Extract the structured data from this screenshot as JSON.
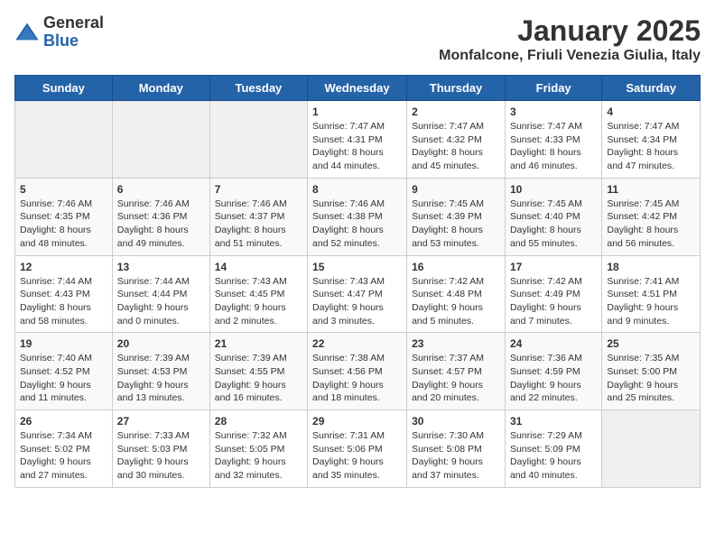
{
  "logo": {
    "general": "General",
    "blue": "Blue"
  },
  "title": "January 2025",
  "subtitle": "Monfalcone, Friuli Venezia Giulia, Italy",
  "days_of_week": [
    "Sunday",
    "Monday",
    "Tuesday",
    "Wednesday",
    "Thursday",
    "Friday",
    "Saturday"
  ],
  "weeks": [
    [
      {
        "day": "",
        "info": ""
      },
      {
        "day": "",
        "info": ""
      },
      {
        "day": "",
        "info": ""
      },
      {
        "day": "1",
        "info": "Sunrise: 7:47 AM\nSunset: 4:31 PM\nDaylight: 8 hours and 44 minutes."
      },
      {
        "day": "2",
        "info": "Sunrise: 7:47 AM\nSunset: 4:32 PM\nDaylight: 8 hours and 45 minutes."
      },
      {
        "day": "3",
        "info": "Sunrise: 7:47 AM\nSunset: 4:33 PM\nDaylight: 8 hours and 46 minutes."
      },
      {
        "day": "4",
        "info": "Sunrise: 7:47 AM\nSunset: 4:34 PM\nDaylight: 8 hours and 47 minutes."
      }
    ],
    [
      {
        "day": "5",
        "info": "Sunrise: 7:46 AM\nSunset: 4:35 PM\nDaylight: 8 hours and 48 minutes."
      },
      {
        "day": "6",
        "info": "Sunrise: 7:46 AM\nSunset: 4:36 PM\nDaylight: 8 hours and 49 minutes."
      },
      {
        "day": "7",
        "info": "Sunrise: 7:46 AM\nSunset: 4:37 PM\nDaylight: 8 hours and 51 minutes."
      },
      {
        "day": "8",
        "info": "Sunrise: 7:46 AM\nSunset: 4:38 PM\nDaylight: 8 hours and 52 minutes."
      },
      {
        "day": "9",
        "info": "Sunrise: 7:45 AM\nSunset: 4:39 PM\nDaylight: 8 hours and 53 minutes."
      },
      {
        "day": "10",
        "info": "Sunrise: 7:45 AM\nSunset: 4:40 PM\nDaylight: 8 hours and 55 minutes."
      },
      {
        "day": "11",
        "info": "Sunrise: 7:45 AM\nSunset: 4:42 PM\nDaylight: 8 hours and 56 minutes."
      }
    ],
    [
      {
        "day": "12",
        "info": "Sunrise: 7:44 AM\nSunset: 4:43 PM\nDaylight: 8 hours and 58 minutes."
      },
      {
        "day": "13",
        "info": "Sunrise: 7:44 AM\nSunset: 4:44 PM\nDaylight: 9 hours and 0 minutes."
      },
      {
        "day": "14",
        "info": "Sunrise: 7:43 AM\nSunset: 4:45 PM\nDaylight: 9 hours and 2 minutes."
      },
      {
        "day": "15",
        "info": "Sunrise: 7:43 AM\nSunset: 4:47 PM\nDaylight: 9 hours and 3 minutes."
      },
      {
        "day": "16",
        "info": "Sunrise: 7:42 AM\nSunset: 4:48 PM\nDaylight: 9 hours and 5 minutes."
      },
      {
        "day": "17",
        "info": "Sunrise: 7:42 AM\nSunset: 4:49 PM\nDaylight: 9 hours and 7 minutes."
      },
      {
        "day": "18",
        "info": "Sunrise: 7:41 AM\nSunset: 4:51 PM\nDaylight: 9 hours and 9 minutes."
      }
    ],
    [
      {
        "day": "19",
        "info": "Sunrise: 7:40 AM\nSunset: 4:52 PM\nDaylight: 9 hours and 11 minutes."
      },
      {
        "day": "20",
        "info": "Sunrise: 7:39 AM\nSunset: 4:53 PM\nDaylight: 9 hours and 13 minutes."
      },
      {
        "day": "21",
        "info": "Sunrise: 7:39 AM\nSunset: 4:55 PM\nDaylight: 9 hours and 16 minutes."
      },
      {
        "day": "22",
        "info": "Sunrise: 7:38 AM\nSunset: 4:56 PM\nDaylight: 9 hours and 18 minutes."
      },
      {
        "day": "23",
        "info": "Sunrise: 7:37 AM\nSunset: 4:57 PM\nDaylight: 9 hours and 20 minutes."
      },
      {
        "day": "24",
        "info": "Sunrise: 7:36 AM\nSunset: 4:59 PM\nDaylight: 9 hours and 22 minutes."
      },
      {
        "day": "25",
        "info": "Sunrise: 7:35 AM\nSunset: 5:00 PM\nDaylight: 9 hours and 25 minutes."
      }
    ],
    [
      {
        "day": "26",
        "info": "Sunrise: 7:34 AM\nSunset: 5:02 PM\nDaylight: 9 hours and 27 minutes."
      },
      {
        "day": "27",
        "info": "Sunrise: 7:33 AM\nSunset: 5:03 PM\nDaylight: 9 hours and 30 minutes."
      },
      {
        "day": "28",
        "info": "Sunrise: 7:32 AM\nSunset: 5:05 PM\nDaylight: 9 hours and 32 minutes."
      },
      {
        "day": "29",
        "info": "Sunrise: 7:31 AM\nSunset: 5:06 PM\nDaylight: 9 hours and 35 minutes."
      },
      {
        "day": "30",
        "info": "Sunrise: 7:30 AM\nSunset: 5:08 PM\nDaylight: 9 hours and 37 minutes."
      },
      {
        "day": "31",
        "info": "Sunrise: 7:29 AM\nSunset: 5:09 PM\nDaylight: 9 hours and 40 minutes."
      },
      {
        "day": "",
        "info": ""
      }
    ]
  ]
}
